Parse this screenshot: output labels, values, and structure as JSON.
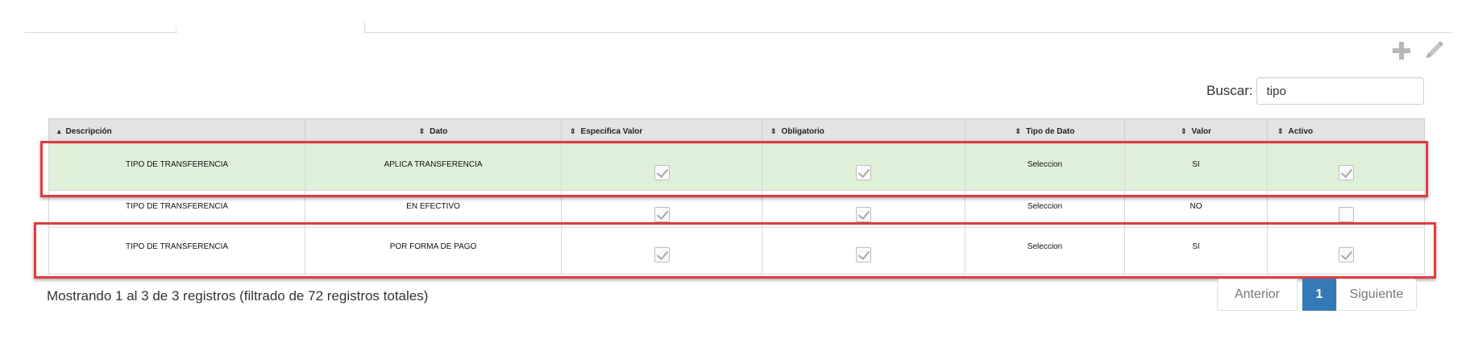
{
  "toolbar": {
    "add_icon": "plus-icon",
    "edit_icon": "pencil-icon"
  },
  "search": {
    "label": "Buscar:",
    "value": "tipo"
  },
  "table": {
    "columns": [
      {
        "label": "Descripción",
        "sort": "asc"
      },
      {
        "label": "Dato",
        "sort": "both"
      },
      {
        "label": "Especifica Valor",
        "sort": "both"
      },
      {
        "label": "Obligatorio",
        "sort": "both"
      },
      {
        "label": "Tipo de Dato",
        "sort": "both"
      },
      {
        "label": "Valor",
        "sort": "both"
      },
      {
        "label": "Activo",
        "sort": "both"
      }
    ],
    "rows": [
      {
        "descripcion": "TIPO DE TRANSFERENCIA",
        "dato": "APLICA TRANSFERENCIA",
        "especifica_valor": true,
        "obligatorio": true,
        "tipo_dato": "Seleccion",
        "valor": "SI",
        "activo": true
      },
      {
        "descripcion": "TIPO DE TRANSFERENCIA",
        "dato": "EN EFECTIVO",
        "especifica_valor": true,
        "obligatorio": true,
        "tipo_dato": "Seleccion",
        "valor": "NO",
        "activo": false
      },
      {
        "descripcion": "TIPO DE TRANSFERENCIA",
        "dato": "POR FORMA DE PAGO",
        "especifica_valor": true,
        "obligatorio": true,
        "tipo_dato": "Seleccion",
        "valor": "SI",
        "activo": true
      }
    ]
  },
  "info": "Mostrando 1 al 3 de 3 registros (filtrado de 72 registros totales)",
  "pagination": {
    "prev": "Anterior",
    "current": "1",
    "next": "Siguiente"
  },
  "colors": {
    "selected_row": "#dff0d8",
    "header_bg": "#e3e3e3",
    "highlight": "#e23b3b",
    "active_page": "#337ab7"
  }
}
